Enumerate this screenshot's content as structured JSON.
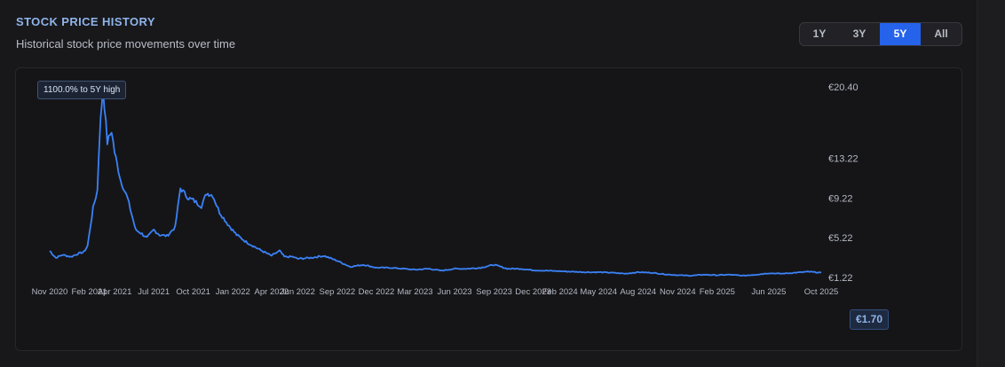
{
  "header": {
    "title": "STOCK PRICE HISTORY",
    "subtitle": "Historical stock price movements over time"
  },
  "range_buttons": [
    {
      "label": "1Y",
      "active": false
    },
    {
      "label": "3Y",
      "active": false
    },
    {
      "label": "5Y",
      "active": true
    },
    {
      "label": "All",
      "active": false
    }
  ],
  "badges": {
    "high_label": "1100.0% to 5Y high",
    "current_price": "€1.70"
  },
  "colors": {
    "accent": "#2563eb",
    "line": "#3b82f6",
    "background": "#18181b"
  },
  "chart_data": {
    "type": "line",
    "currency": "€",
    "y_tick_labels": [
      "€20.40",
      "€13.22",
      "€9.22",
      "€5.22",
      "€1.22"
    ],
    "y_ticks": [
      20.4,
      13.22,
      9.22,
      5.22,
      1.22
    ],
    "ylim": [
      1.22,
      20.4
    ],
    "x_tick_labels": [
      "Nov 2020",
      "Feb 2021",
      "Apr 2021",
      "Jul 2021",
      "Oct 2021",
      "Jan 2022",
      "Apr 2022",
      "Jun 2022",
      "Sep 2022",
      "Dec 2022",
      "Mar 2023",
      "Jun 2023",
      "Sep 2023",
      "Dec 2023",
      "Feb 2024",
      "May 2024",
      "Aug 2024",
      "Nov 2024",
      "Feb 2025",
      "Jun 2025",
      "Oct 2025"
    ],
    "x_ticks": [
      "2020-11-01",
      "2021-02-01",
      "2021-04-01",
      "2021-07-01",
      "2021-10-01",
      "2022-01-01",
      "2022-04-01",
      "2022-06-01",
      "2022-09-01",
      "2022-12-01",
      "2023-03-01",
      "2023-06-01",
      "2023-09-01",
      "2023-12-01",
      "2024-02-01",
      "2024-05-01",
      "2024-08-01",
      "2024-11-01",
      "2025-02-01",
      "2025-06-01",
      "2025-10-01"
    ],
    "grid": false,
    "series": [
      {
        "x": [
          "2020-11-01",
          "2020-11-15",
          "2020-12-01",
          "2020-12-20",
          "2021-01-05",
          "2021-01-20",
          "2021-01-28",
          "2021-02-10",
          "2021-02-20",
          "2021-02-25",
          "2021-03-05",
          "2021-03-15",
          "2021-03-25",
          "2021-04-01",
          "2021-04-15",
          "2021-05-01",
          "2021-05-20",
          "2021-06-01",
          "2021-06-15",
          "2021-07-01",
          "2021-07-15",
          "2021-08-01",
          "2021-08-20",
          "2021-09-01",
          "2021-09-20",
          "2021-10-01",
          "2021-10-20",
          "2021-11-01",
          "2021-11-15",
          "2021-12-01",
          "2021-12-20",
          "2022-01-10",
          "2022-02-01",
          "2022-03-01",
          "2022-04-01",
          "2022-04-20",
          "2022-05-01",
          "2022-05-20",
          "2022-06-01",
          "2022-07-01",
          "2022-08-01",
          "2022-09-01",
          "2022-10-01",
          "2022-11-01",
          "2022-12-01",
          "2023-01-01",
          "2023-02-01",
          "2023-03-01",
          "2023-04-01",
          "2023-05-01",
          "2023-06-01",
          "2023-07-01",
          "2023-08-01",
          "2023-09-01",
          "2023-10-01",
          "2023-11-01",
          "2023-12-01",
          "2024-01-01",
          "2024-02-01",
          "2024-03-01",
          "2024-04-01",
          "2024-05-01",
          "2024-06-01",
          "2024-07-01",
          "2024-08-01",
          "2024-09-01",
          "2024-10-01",
          "2024-11-01",
          "2024-12-01",
          "2025-01-01",
          "2025-02-01",
          "2025-03-01",
          "2025-04-01",
          "2025-05-01",
          "2025-06-01",
          "2025-07-01",
          "2025-08-01",
          "2025-09-01",
          "2025-10-01"
        ],
        "values": [
          3.9,
          3.2,
          3.5,
          3.3,
          3.6,
          3.8,
          4.4,
          8.2,
          10.0,
          15.5,
          20.4,
          14.8,
          16.0,
          13.8,
          11.0,
          9.2,
          6.0,
          5.7,
          5.2,
          6.0,
          5.5,
          5.4,
          6.3,
          10.2,
          9.2,
          9.0,
          8.4,
          9.7,
          9.5,
          7.8,
          6.6,
          5.5,
          4.8,
          4.1,
          3.4,
          3.9,
          3.3,
          3.3,
          3.1,
          3.2,
          3.4,
          2.9,
          2.3,
          2.5,
          2.2,
          2.2,
          2.1,
          2.0,
          2.1,
          1.9,
          2.1,
          2.1,
          2.2,
          2.5,
          2.1,
          2.1,
          1.95,
          1.9,
          1.85,
          1.8,
          1.75,
          1.75,
          1.7,
          1.6,
          1.75,
          1.7,
          1.55,
          1.45,
          1.4,
          1.5,
          1.45,
          1.5,
          1.4,
          1.5,
          1.65,
          1.6,
          1.7,
          1.8,
          1.7
        ]
      }
    ]
  }
}
